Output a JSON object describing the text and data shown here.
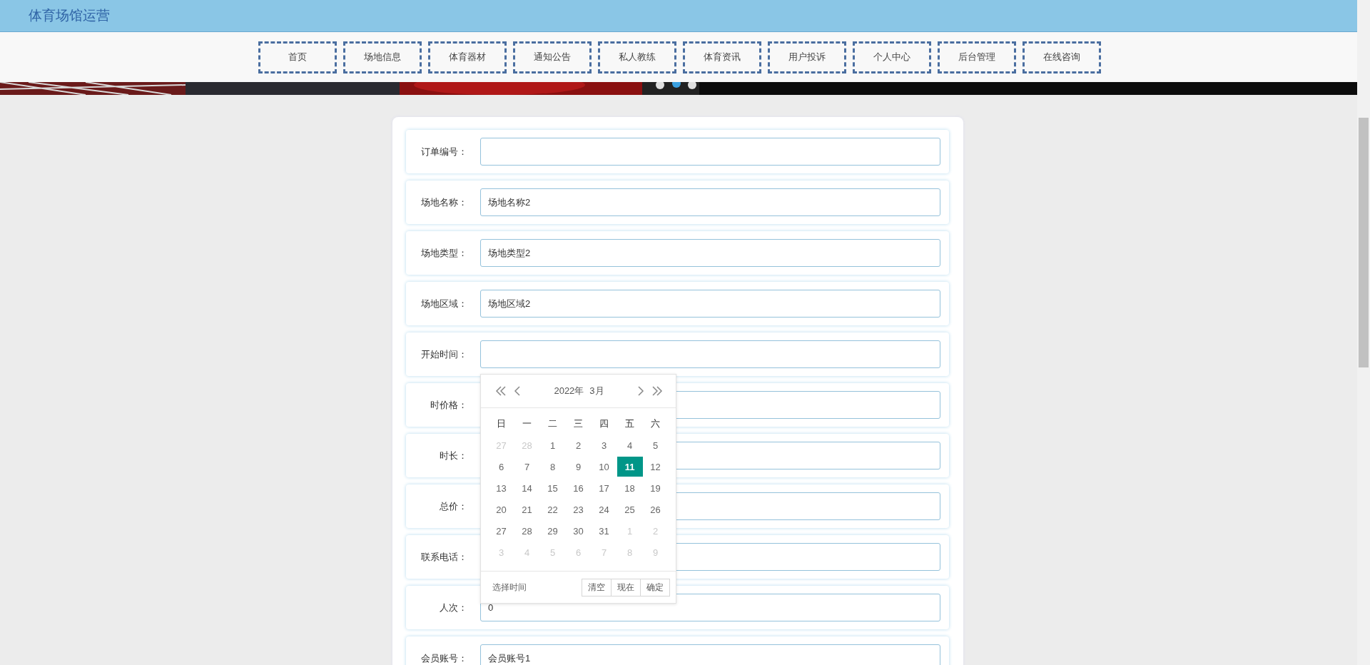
{
  "header": {
    "title": "体育场馆运营"
  },
  "nav": [
    "首页",
    "场地信息",
    "体育器材",
    "通知公告",
    "私人教练",
    "体育资讯",
    "用户投诉",
    "个人中心",
    "后台管理",
    "在线咨询"
  ],
  "banner": {
    "kind": "picture"
  },
  "form": {
    "rows": [
      {
        "label": "订单编号："
      },
      {
        "label": "场地名称：",
        "value": "场地名称2"
      },
      {
        "label": "场地类型：",
        "value": "场地类型2"
      },
      {
        "label": "场地区域：",
        "value": "场地区域2"
      },
      {
        "label": "开始时间："
      },
      {
        "label": "时价格："
      },
      {
        "label": "时长："
      },
      {
        "label": "总价："
      },
      {
        "label": "联系电话："
      },
      {
        "label": "人次：",
        "value": "0"
      },
      {
        "label": "会员账号：",
        "value": "会员账号1"
      }
    ]
  },
  "calendar": {
    "year": "2022年",
    "month": "3月",
    "weekdays": [
      "日",
      "一",
      "二",
      "三",
      "四",
      "五",
      "六"
    ],
    "days": [
      {
        "day": "27",
        "kind": "other",
        "selected": false
      },
      {
        "day": "28",
        "kind": "other",
        "selected": false
      },
      {
        "day": "1",
        "kind": "current",
        "selected": false
      },
      {
        "day": "2",
        "kind": "current",
        "selected": false
      },
      {
        "day": "3",
        "kind": "current",
        "selected": false
      },
      {
        "day": "4",
        "kind": "current",
        "selected": false
      },
      {
        "day": "5",
        "kind": "current",
        "selected": false
      },
      {
        "day": "6",
        "kind": "current",
        "selected": false
      },
      {
        "day": "7",
        "kind": "current",
        "selected": false
      },
      {
        "day": "8",
        "kind": "current",
        "selected": false
      },
      {
        "day": "9",
        "kind": "current",
        "selected": false
      },
      {
        "day": "10",
        "kind": "current",
        "selected": false
      },
      {
        "day": "11",
        "kind": "current",
        "selected": true
      },
      {
        "day": "12",
        "kind": "current",
        "selected": false
      },
      {
        "day": "13",
        "kind": "current",
        "selected": false
      },
      {
        "day": "14",
        "kind": "current",
        "selected": false
      },
      {
        "day": "15",
        "kind": "current",
        "selected": false
      },
      {
        "day": "16",
        "kind": "current",
        "selected": false
      },
      {
        "day": "17",
        "kind": "current",
        "selected": false
      },
      {
        "day": "18",
        "kind": "current",
        "selected": false
      },
      {
        "day": "19",
        "kind": "current",
        "selected": false
      },
      {
        "day": "20",
        "kind": "current",
        "selected": false
      },
      {
        "day": "21",
        "kind": "current",
        "selected": false
      },
      {
        "day": "22",
        "kind": "current",
        "selected": false
      },
      {
        "day": "23",
        "kind": "current",
        "selected": false
      },
      {
        "day": "24",
        "kind": "current",
        "selected": false
      },
      {
        "day": "25",
        "kind": "current",
        "selected": false
      },
      {
        "day": "26",
        "kind": "current",
        "selected": false
      },
      {
        "day": "27",
        "kind": "current",
        "selected": false
      },
      {
        "day": "28",
        "kind": "current",
        "selected": false
      },
      {
        "day": "29",
        "kind": "current",
        "selected": false
      },
      {
        "day": "30",
        "kind": "current",
        "selected": false
      },
      {
        "day": "31",
        "kind": "current",
        "selected": false
      },
      {
        "day": "1",
        "kind": "other",
        "selected": false
      },
      {
        "day": "2",
        "kind": "other",
        "selected": false
      },
      {
        "day": "3",
        "kind": "other",
        "selected": false
      },
      {
        "day": "4",
        "kind": "other",
        "selected": false
      },
      {
        "day": "5",
        "kind": "other",
        "selected": false
      },
      {
        "day": "6",
        "kind": "other",
        "selected": false
      },
      {
        "day": "7",
        "kind": "other",
        "selected": false
      },
      {
        "day": "8",
        "kind": "other",
        "selected": false
      },
      {
        "day": "9",
        "kind": "other",
        "selected": false
      }
    ],
    "footer_label": "选择时间",
    "buttons": [
      "清空",
      "现在",
      "确定"
    ]
  }
}
